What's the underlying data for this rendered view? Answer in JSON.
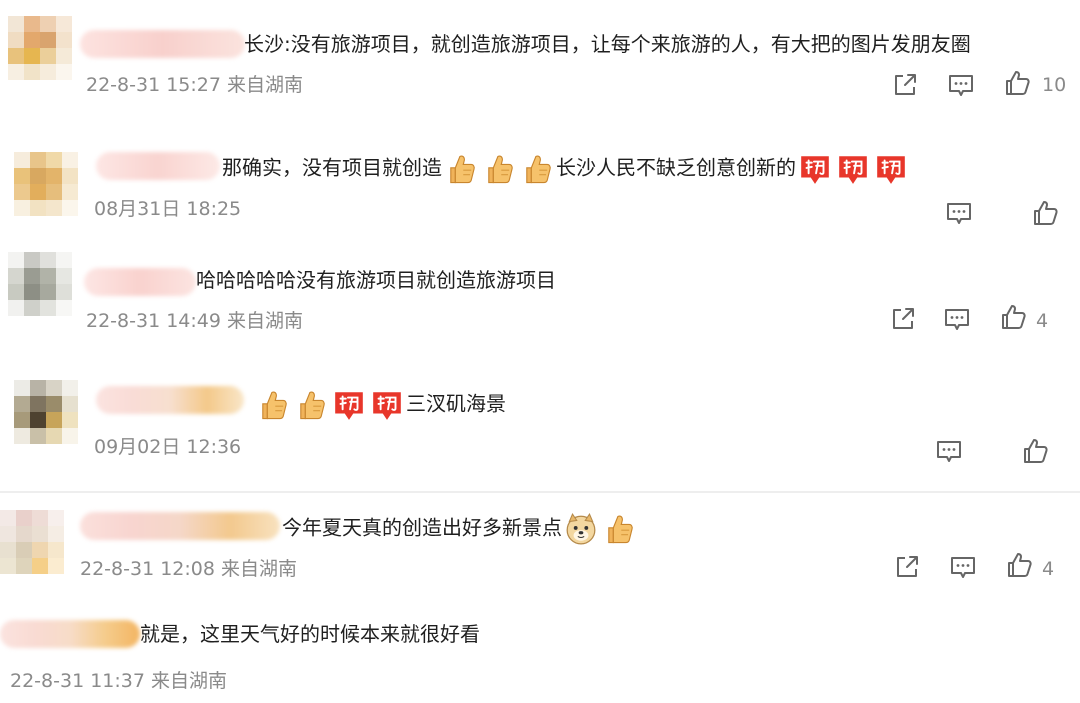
{
  "comments": [
    {
      "text": "长沙:没有旅游项目，就创造旅游项目，让每个来旅游的人，有大把的图片发朋友圈",
      "meta": "22-8-31 15:27 来自湖南",
      "like_count": "10"
    },
    {
      "text_a": "那确实，没有项目就创造",
      "text_b": "长沙人民不缺乏创意创新的",
      "meta": "08月31日 18:25"
    },
    {
      "text": "哈哈哈哈哈没有旅游项目就创造旅游项目",
      "meta": "22-8-31 14:49 来自湖南",
      "like_count": "4"
    },
    {
      "text": "三汊矶海景",
      "meta": "09月02日 12:36"
    },
    {
      "text": "今年夏天真的创造出好多新景点",
      "meta": "22-8-31 12:08 来自湖南",
      "like_count": "4"
    },
    {
      "text": "就是，这里天气好的时候本来就很好看",
      "meta": "22-8-31 11:37 来自湖南"
    }
  ],
  "icons": {
    "forward": "share-icon",
    "comment": "comment-icon",
    "like": "thumbs-up-icon",
    "emoji_like": "thumbs-up-emoji",
    "emoji_cheer": "cheer-emoji",
    "emoji_doge": "doge-emoji"
  },
  "colors": {
    "text": "#1f1f1f",
    "meta": "#8a8a8a",
    "cheer_red": "#e8362a"
  }
}
